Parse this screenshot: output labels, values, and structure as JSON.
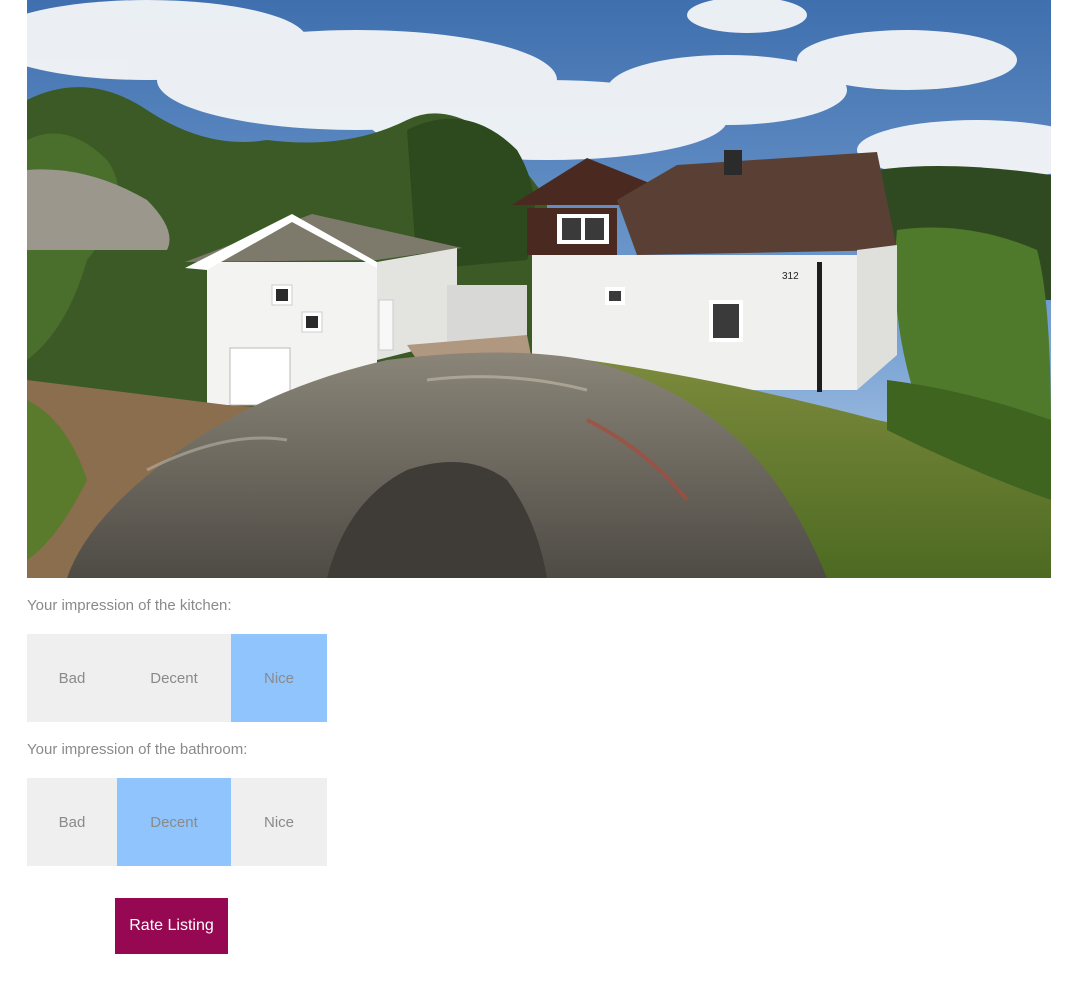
{
  "photo": {
    "house_number": "312"
  },
  "kitchen": {
    "question": "Your impression of the kitchen:",
    "options": [
      "Bad",
      "Decent",
      "Nice"
    ],
    "selected": "Nice"
  },
  "bathroom": {
    "question": "Your impression of the bathroom:",
    "options": [
      "Bad",
      "Decent",
      "Nice"
    ],
    "selected": "Decent"
  },
  "submit": {
    "label": "Rate Listing"
  },
  "colors": {
    "selected_option": "#90c4fc",
    "unselected_option": "#efefef",
    "button": "#960852"
  }
}
